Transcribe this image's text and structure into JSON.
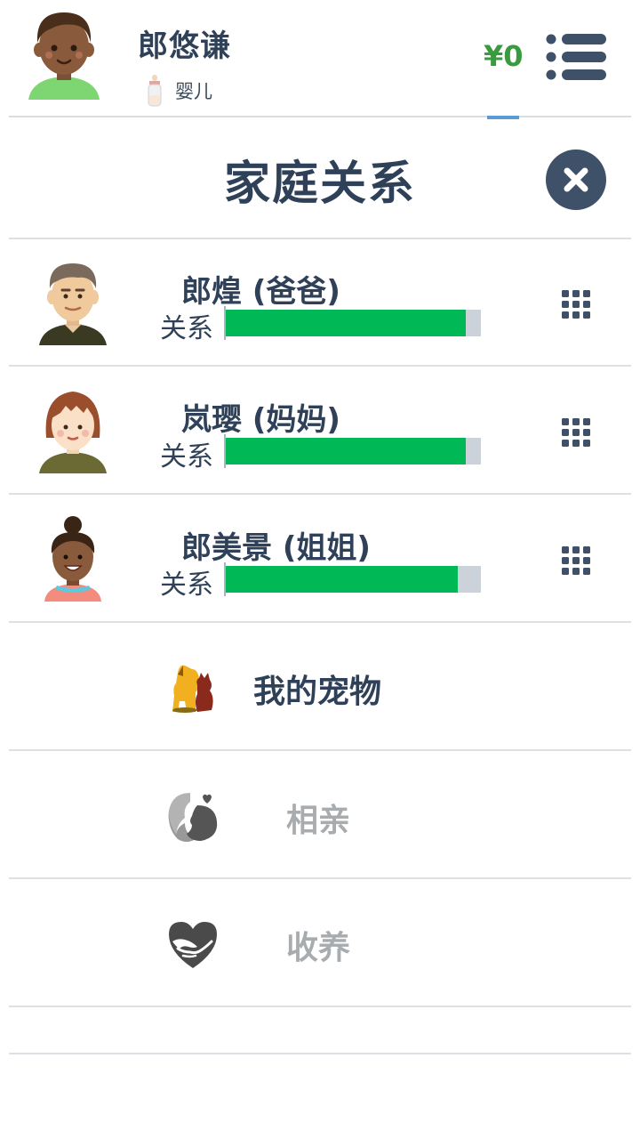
{
  "header": {
    "name": "郎悠谦",
    "stage": "婴儿",
    "money": "¥0"
  },
  "section": {
    "title": "家庭关系"
  },
  "members": [
    {
      "name": "郎煌 (爸爸)",
      "relation_label": "关系",
      "relation_level": 0.94
    },
    {
      "name": "岚璎 (妈妈)",
      "relation_label": "关系",
      "relation_level": 0.94
    },
    {
      "name": "郎美景 (姐姐)",
      "relation_label": "关系",
      "relation_level": 0.91
    }
  ],
  "actions": [
    {
      "label": "我的宠物",
      "icon": "pet-icon",
      "enabled": true
    },
    {
      "label": "相亲",
      "icon": "matchmaking-icon",
      "enabled": false
    },
    {
      "label": "收养",
      "icon": "adopt-icon",
      "enabled": false
    }
  ],
  "colors": {
    "relation_bar": "#00b855",
    "money": "#3a9a40",
    "disabled_text": "#a9acaf"
  }
}
